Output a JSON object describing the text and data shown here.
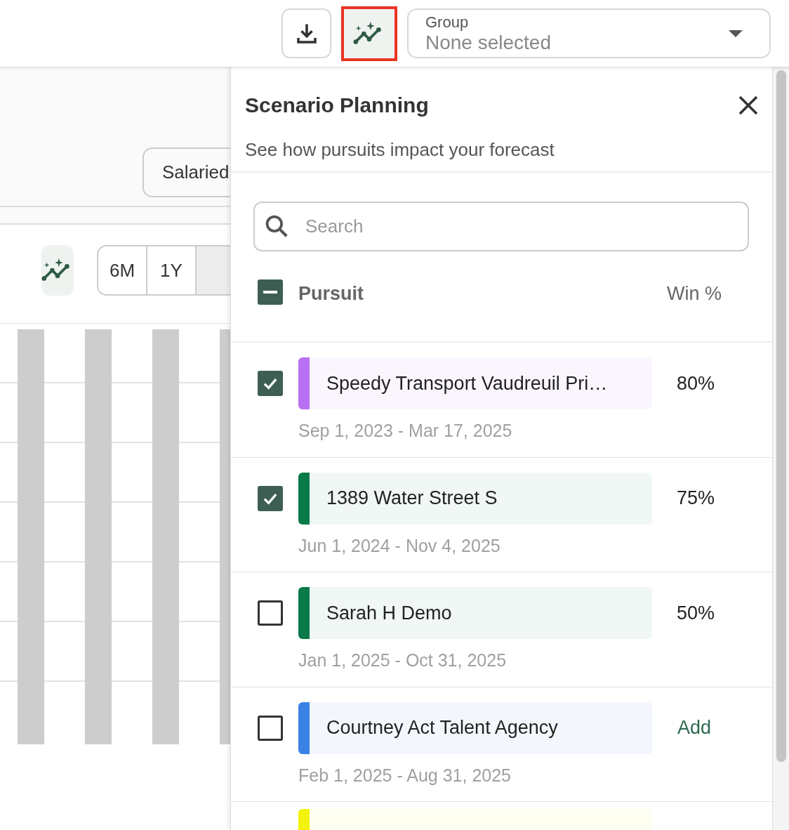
{
  "toolbar": {
    "insights_button": {
      "highlighted": true
    },
    "group_select": {
      "label": "Group",
      "value": "None selected"
    }
  },
  "left": {
    "filter_button": "Salaried",
    "ranges": [
      {
        "label": "6M",
        "selected": false
      },
      {
        "label": "1Y",
        "selected": false
      },
      {
        "selected": true
      }
    ]
  },
  "panel": {
    "title": "Scenario Planning",
    "subtitle": "See how pursuits impact your forecast",
    "search": {
      "placeholder": "Search"
    },
    "header": {
      "select_all_indeterminate": true,
      "pursuit": "Pursuit",
      "win": "Win %"
    },
    "rows": [
      {
        "name": "Speedy Transport Vaudreuil Pri…",
        "dates": "Sep 1, 2023 - Mar 17, 2025",
        "kind": "percent",
        "win": "80%",
        "checked": true,
        "color": "#b970f2"
      },
      {
        "name": "1389 Water Street S",
        "dates": "Jun 1, 2024 - Nov 4, 2025",
        "kind": "percent",
        "win": "75%",
        "checked": true,
        "color": "#0a7a4a"
      },
      {
        "name": "Sarah H Demo",
        "dates": "Jan 1, 2025 - Oct 31, 2025",
        "kind": "percent",
        "win": "50%",
        "checked": false,
        "color": "#0a7a4a"
      },
      {
        "name": "Courtney Act Talent Agency",
        "dates": "Feb 1, 2025 - Aug 31, 2025",
        "kind": "add",
        "win": "Add",
        "checked": false,
        "color": "#3b82e6"
      },
      {
        "kind": "partial",
        "color": "#f2f20a"
      }
    ]
  }
}
